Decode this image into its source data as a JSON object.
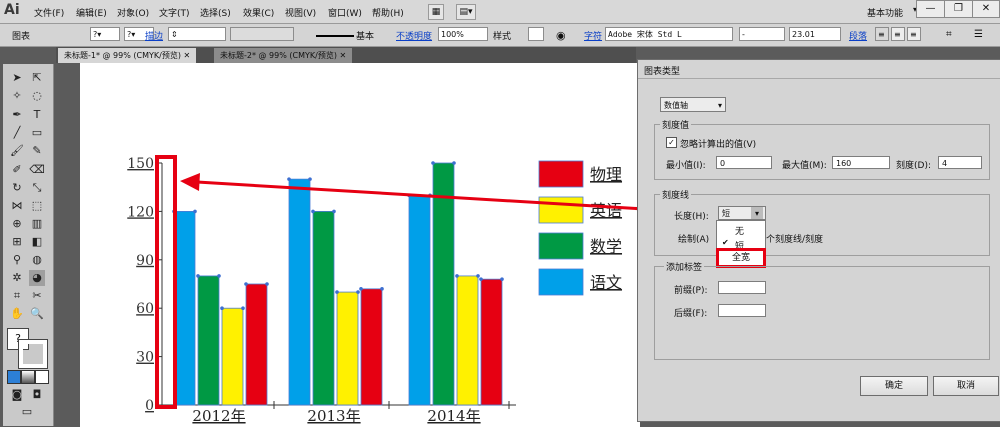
{
  "app": {
    "logo": "Ai",
    "menus": [
      "文件(F)",
      "编辑(E)",
      "对象(O)",
      "文字(T)",
      "选择(S)",
      "效果(C)",
      "视图(V)",
      "窗口(W)",
      "帮助(H)"
    ],
    "workspace": "基本功能"
  },
  "control_bar": {
    "selection_label": "图表",
    "stroke_label": "描边",
    "stroke_style": "基本",
    "opacity_label": "不透明度",
    "opacity_value": "100%",
    "style_label": "样式",
    "char_label": "字符",
    "font_name": "Adobe 宋体 Std L",
    "font_style": "-",
    "font_size": "23.01",
    "para_label": "段落"
  },
  "tabs": [
    {
      "label": "未标题-1* @ 99% (CMYK/预览)"
    },
    {
      "label": "未标题-2* @ 99% (CMYK/预览)"
    }
  ],
  "chart_data": {
    "type": "bar",
    "categories": [
      "2012年",
      "2013年",
      "2014年"
    ],
    "series": [
      {
        "name": "语文",
        "color": "#00a0e9",
        "values": [
          120,
          140,
          130
        ]
      },
      {
        "name": "数学",
        "color": "#009944",
        "values": [
          80,
          120,
          150
        ]
      },
      {
        "name": "英语",
        "color": "#fff100",
        "values": [
          60,
          70,
          80
        ]
      },
      {
        "name": "物理",
        "color": "#e60012",
        "values": [
          75,
          72,
          78
        ]
      }
    ],
    "legend_order": [
      "物理",
      "英语",
      "数学",
      "语文"
    ],
    "yticks": [
      "0",
      "30",
      "60",
      "90",
      "120",
      "150"
    ],
    "ylim": [
      0,
      150
    ],
    "legend_position": "right"
  },
  "dialog": {
    "title": "图表类型",
    "type_select": "数值轴",
    "tick_values_group": "刻度值",
    "override_checkbox": "忽略计算出的值(V)",
    "min_label": "最小值(I):",
    "min_value": "0",
    "max_label": "最大值(M):",
    "max_value": "160",
    "divisions_label": "刻度(D):",
    "divisions_value": "4",
    "tick_marks_group": "刻度线",
    "length_label": "长度(H):",
    "length_value": "短",
    "draw_label": "绘制(A)",
    "draw_suffix": "个刻度线/刻度",
    "length_options": [
      "无",
      "短",
      "全宽"
    ],
    "add_labels_group": "添加标签",
    "prefix_label": "前缀(P):",
    "suffix_label": "后缀(F):",
    "ok_label": "确定",
    "cancel_label": "取消"
  }
}
